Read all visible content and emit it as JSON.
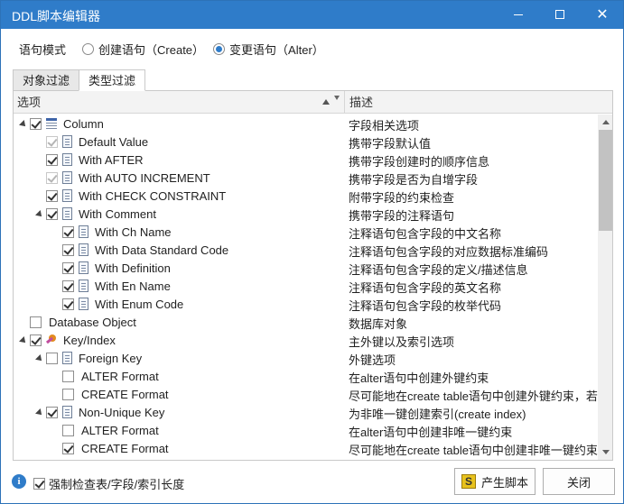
{
  "window": {
    "title": "DDL脚本编辑器"
  },
  "mode": {
    "label": "语句模式",
    "options": [
      {
        "label": "创建语句（Create）",
        "selected": false
      },
      {
        "label": "变更语句（Alter）",
        "selected": true
      }
    ]
  },
  "tabs": [
    {
      "label": "对象过滤",
      "active": false
    },
    {
      "label": "类型过滤",
      "active": true
    }
  ],
  "grid": {
    "headers": {
      "option": "选项",
      "description": "描述"
    },
    "rows": [
      {
        "label": "Column",
        "desc": "字段相关选项",
        "level": 0,
        "expander": true,
        "checked": true,
        "disabled": false,
        "icon": "column-icon"
      },
      {
        "label": "Default Value",
        "desc": "携带字段默认值",
        "level": 1,
        "expander": false,
        "checked": true,
        "disabled": true,
        "icon": "doc-icon"
      },
      {
        "label": "With AFTER",
        "desc": "携带字段创建时的顺序信息",
        "level": 1,
        "expander": false,
        "checked": true,
        "disabled": false,
        "icon": "doc-icon"
      },
      {
        "label": "With AUTO INCREMENT",
        "desc": "携带字段是否为自增字段",
        "level": 1,
        "expander": false,
        "checked": true,
        "disabled": true,
        "icon": "doc-icon"
      },
      {
        "label": "With CHECK CONSTRAINT",
        "desc": "附带字段的约束检查",
        "level": 1,
        "expander": false,
        "checked": true,
        "disabled": false,
        "icon": "doc-icon"
      },
      {
        "label": "With Comment",
        "desc": "携带字段的注释语句",
        "level": 1,
        "expander": true,
        "checked": true,
        "disabled": false,
        "icon": "doc-icon"
      },
      {
        "label": "With Ch Name",
        "desc": "注释语句包含字段的中文名称",
        "level": 2,
        "expander": false,
        "checked": true,
        "disabled": false,
        "icon": "doc-icon"
      },
      {
        "label": "With Data Standard Code",
        "desc": "注释语句包含字段的对应数据标准编码",
        "level": 2,
        "expander": false,
        "checked": true,
        "disabled": false,
        "icon": "doc-icon"
      },
      {
        "label": "With Definition",
        "desc": "注释语句包含字段的定义/描述信息",
        "level": 2,
        "expander": false,
        "checked": true,
        "disabled": false,
        "icon": "doc-icon"
      },
      {
        "label": "With En Name",
        "desc": "注释语句包含字段的英文名称",
        "level": 2,
        "expander": false,
        "checked": true,
        "disabled": false,
        "icon": "doc-icon"
      },
      {
        "label": "With Enum Code",
        "desc": "注释语句包含字段的枚举代码",
        "level": 2,
        "expander": false,
        "checked": true,
        "disabled": false,
        "icon": "doc-icon"
      },
      {
        "label": "Database Object",
        "desc": "数据库对象",
        "level": 0,
        "expander": false,
        "checked": false,
        "disabled": false,
        "icon": "none"
      },
      {
        "label": "Key/Index",
        "desc": "主外键以及索引选项",
        "level": 0,
        "expander": true,
        "checked": true,
        "disabled": false,
        "icon": "key-icon"
      },
      {
        "label": "Foreign Key",
        "desc": "外键选项",
        "level": 1,
        "expander": true,
        "checked": false,
        "disabled": false,
        "icon": "doc-icon"
      },
      {
        "label": "ALTER Format",
        "desc": "在alter语句中创建外键约束",
        "level": 2,
        "expander": false,
        "checked": false,
        "disabled": false,
        "icon": "none"
      },
      {
        "label": "CREATE Format",
        "desc": "尽可能地在create table语句中创建外键约束，若...",
        "level": 2,
        "expander": false,
        "checked": false,
        "disabled": false,
        "icon": "none"
      },
      {
        "label": "Non-Unique Key",
        "desc": "为非唯一键创建索引(create index)",
        "level": 1,
        "expander": true,
        "checked": true,
        "disabled": false,
        "icon": "doc-icon"
      },
      {
        "label": "ALTER Format",
        "desc": "在alter语句中创建非唯一键约束",
        "level": 2,
        "expander": false,
        "checked": false,
        "disabled": false,
        "icon": "none"
      },
      {
        "label": "CREATE Format",
        "desc": "尽可能地在create table语句中创建非唯一键约束，...",
        "level": 2,
        "expander": false,
        "checked": true,
        "disabled": false,
        "icon": "none"
      }
    ]
  },
  "footer": {
    "force_check_label": "强制检查表/字段/索引长度",
    "force_check_checked": true,
    "generate_label": "产生脚本",
    "close_label": "关闭"
  }
}
